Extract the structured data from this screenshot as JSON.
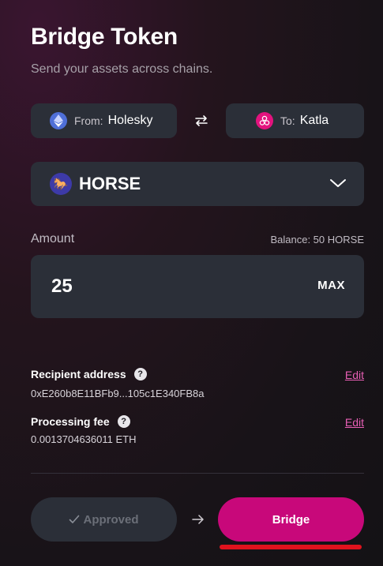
{
  "header": {
    "title": "Bridge Token",
    "subtitle": "Send your assets across chains."
  },
  "chains": {
    "from_prefix": "From:",
    "from_name": "Holesky",
    "to_prefix": "To:",
    "to_name": "Katla"
  },
  "token": {
    "symbol": "HORSE"
  },
  "amount": {
    "label": "Amount",
    "balance": "Balance: 50 HORSE",
    "value": "25",
    "max_label": "MAX"
  },
  "recipient": {
    "label": "Recipient address",
    "value": "0xE260b8E11BFb9...105c1E340FB8a",
    "edit_label": "Edit"
  },
  "fee": {
    "label": "Processing fee",
    "value": "0.0013704636011 ETH",
    "edit_label": "Edit"
  },
  "actions": {
    "approved_label": "Approved",
    "bridge_label": "Bridge"
  },
  "colors": {
    "accent": "#c8087a",
    "link": "#e85fb5",
    "highlight": "#e0121d"
  }
}
